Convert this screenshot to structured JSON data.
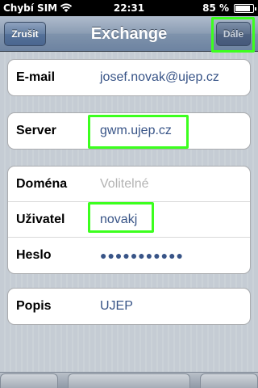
{
  "status_bar": {
    "carrier": "Chybí SIM",
    "time": "22:31",
    "battery": "85 %",
    "wifi_icon": "wifi-icon",
    "battery_icon": "battery-icon"
  },
  "nav": {
    "title": "Exchange",
    "cancel_label": "Zrušit",
    "next_label": "Dále"
  },
  "account": {
    "email_label": "E-mail",
    "email_value": "josef.novak@ujep.cz"
  },
  "server": {
    "label": "Server",
    "value": "gwm.ujep.cz"
  },
  "credentials": {
    "domain_label": "Doména",
    "domain_placeholder": "Volitelné",
    "user_label": "Uživatel",
    "user_value": "novakj",
    "password_label": "Heslo",
    "password_value": "●●●●●●●●●●●"
  },
  "description": {
    "label": "Popis",
    "value": "UJEP"
  },
  "colors": {
    "highlight": "#3cff1e",
    "value_text": "#385487",
    "nav_bar": "#6d83a1"
  }
}
